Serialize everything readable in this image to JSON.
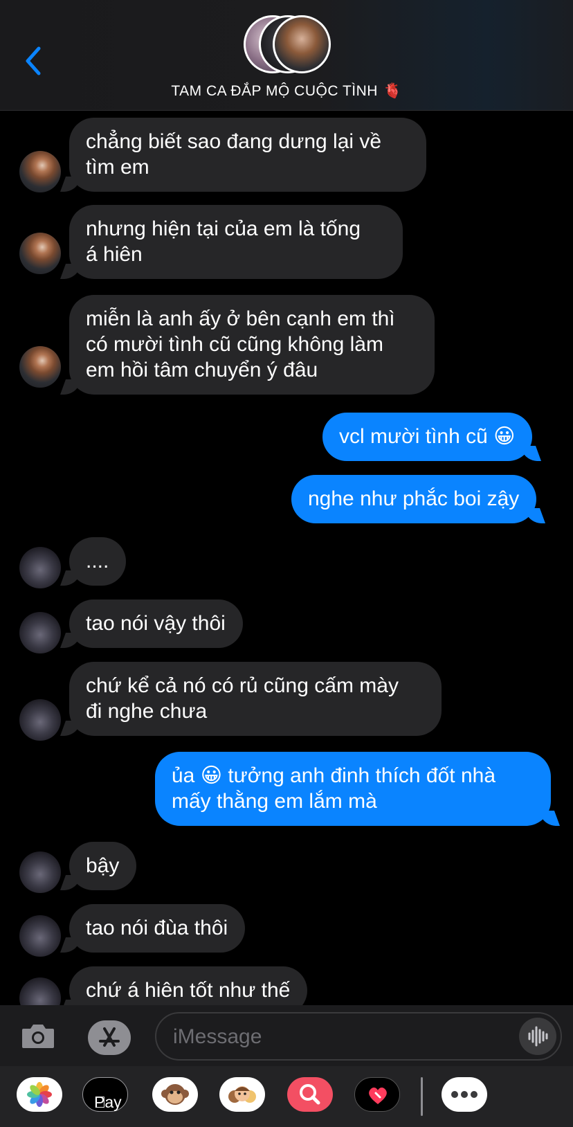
{
  "header": {
    "back_label": "Back",
    "group_title": "TAM CA ĐẮP MỘ CUỘC TÌNH",
    "title_emoji": "🫀"
  },
  "messages": [
    {
      "from": "a",
      "lines": [
        "chẳng biết sao đang dưng lại về",
        "tìm em"
      ]
    },
    {
      "from": "a",
      "lines": [
        "nhưng hiện tại của em là tống",
        "á hiên"
      ]
    },
    {
      "from": "a",
      "lines": [
        "miễn là anh ấy ở bên cạnh em thì",
        "có mười tình cũ cũng không làm",
        "em hồi tâm chuyển ý đâu"
      ]
    },
    {
      "from": "me",
      "lines": [
        "vcl mười tình cũ 😀"
      ]
    },
    {
      "from": "me",
      "lines": [
        "nghe như phắc boi zậy"
      ]
    },
    {
      "from": "b",
      "lines": [
        "...."
      ]
    },
    {
      "from": "b",
      "lines": [
        "tao nói vậy thôi"
      ]
    },
    {
      "from": "b",
      "lines": [
        "chứ kể cả nó có rủ cũng cấm mày",
        "đi nghe chưa"
      ]
    },
    {
      "from": "me",
      "lines": [
        "ủa 😀 tưởng anh đinh thích đốt nhà",
        "mấy thằng em lắm mà"
      ]
    },
    {
      "from": "b",
      "lines": [
        "bậy"
      ]
    },
    {
      "from": "b",
      "lines": [
        "tao nói đùa thôi"
      ]
    },
    {
      "from": "b",
      "lines": [
        "chứ á hiên tốt như thế"
      ]
    }
  ],
  "input": {
    "placeholder": "iMessage"
  },
  "apps": {
    "pay_label": "Pay"
  },
  "colors": {
    "outgoing_bubble": "#0a84ff",
    "incoming_bubble": "#262628",
    "background": "#000000"
  },
  "icons": {
    "back": "chevron-left-icon",
    "camera": "camera-icon",
    "apps": "app-store-icon",
    "voice": "waveform-icon",
    "photos": "photos-app-icon",
    "apple_pay": "apple-pay-icon",
    "animoji": "monkey-animoji-icon",
    "memoji": "memoji-icon",
    "search": "image-search-icon",
    "heart": "digital-touch-heart-icon",
    "more": "more-dots-icon"
  }
}
